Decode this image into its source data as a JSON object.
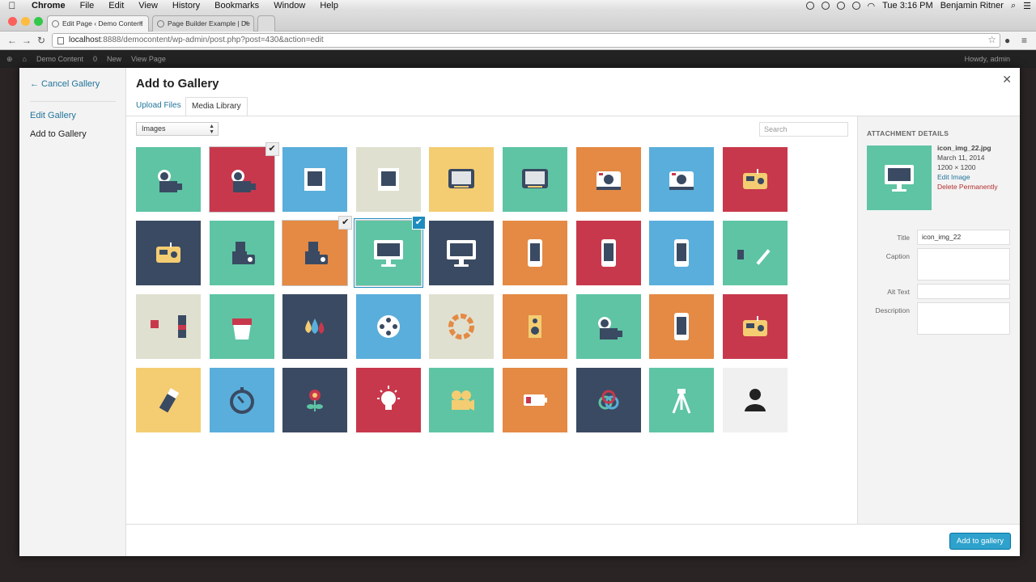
{
  "menubar": {
    "app": "Chrome",
    "items": [
      "File",
      "Edit",
      "View",
      "History",
      "Bookmarks",
      "Window",
      "Help"
    ],
    "clock": "Tue 3:16 PM",
    "user": "Benjamin Ritner"
  },
  "browser": {
    "tabs": [
      "Edit Page ‹ Demo Content",
      "Page Builder Example | De"
    ],
    "url_host": "localhost",
    "url_rest": ":8888/democontent/wp-admin/post.php?post=430&action=edit"
  },
  "adminbar": {
    "items": [
      "Demo Content",
      "0",
      "New",
      "View Page"
    ],
    "howdy": "Howdy, admin"
  },
  "modal": {
    "menu": {
      "cancel": "← Cancel Gallery",
      "edit": "Edit Gallery",
      "add": "Add to Gallery"
    },
    "title": "Add to Gallery",
    "tabs": {
      "upload": "Upload Files",
      "library": "Media Library"
    },
    "filter": "Images",
    "search_placeholder": "Search",
    "add_button": "Add to gallery"
  },
  "tiles": [
    {
      "bg": "#5ec4a4",
      "icon": "camcorder"
    },
    {
      "bg": "#c8384c",
      "icon": "camcorder",
      "selected": true
    },
    {
      "bg": "#5aaedb",
      "icon": "frame"
    },
    {
      "bg": "#e0e0d0",
      "icon": "frame"
    },
    {
      "bg": "#f4cd72",
      "icon": "tv"
    },
    {
      "bg": "#5ec4a4",
      "icon": "tv"
    },
    {
      "bg": "#e48a44",
      "icon": "polaroid"
    },
    {
      "bg": "#5aaedb",
      "icon": "polaroid"
    },
    {
      "bg": "#c8384c",
      "icon": "radio"
    },
    {
      "bg": "#3a4a62",
      "icon": "radio"
    },
    {
      "bg": "#5ec4a4",
      "icon": "camera-set"
    },
    {
      "bg": "#e48a44",
      "icon": "camera-set",
      "selected": true
    },
    {
      "bg": "#5ec4a4",
      "icon": "monitor",
      "selected": true,
      "current": true
    },
    {
      "bg": "#3a4a62",
      "icon": "monitor"
    },
    {
      "bg": "#e48a44",
      "icon": "phone"
    },
    {
      "bg": "#c8384c",
      "icon": "phone"
    },
    {
      "bg": "#5aaedb",
      "icon": "phone"
    },
    {
      "bg": "#5ec4a4",
      "icon": "pencil"
    },
    {
      "bg": "#e0e0d0",
      "icon": "paint"
    },
    {
      "bg": "#5ec4a4",
      "icon": "bucket"
    },
    {
      "bg": "#3a4a62",
      "icon": "drops"
    },
    {
      "bg": "#5aaedb",
      "icon": "reel"
    },
    {
      "bg": "#e0e0d0",
      "icon": "wheel"
    },
    {
      "bg": "#e48a44",
      "icon": "speaker"
    },
    {
      "bg": "#5ec4a4",
      "icon": "camcorder"
    },
    {
      "bg": "#e48a44",
      "icon": "phone"
    },
    {
      "bg": "#c8384c",
      "icon": "radio"
    },
    {
      "bg": "#f4cd72",
      "icon": "marker"
    },
    {
      "bg": "#5aaedb",
      "icon": "timer"
    },
    {
      "bg": "#3a4a62",
      "icon": "flower"
    },
    {
      "bg": "#c8384c",
      "icon": "bulb"
    },
    {
      "bg": "#5ec4a4",
      "icon": "projector"
    },
    {
      "bg": "#e48a44",
      "icon": "battery"
    },
    {
      "bg": "#3a4a62",
      "icon": "rings"
    },
    {
      "bg": "#5ec4a4",
      "icon": "tripod"
    },
    {
      "bg": "#f0f0f0",
      "icon": "person"
    }
  ],
  "details": {
    "heading": "ATTACHMENT DETAILS",
    "filename": "icon_img_22.jpg",
    "date": "March 11, 2014",
    "dimensions": "1200 × 1200",
    "edit": "Edit Image",
    "delete": "Delete Permanently",
    "labels": {
      "title": "Title",
      "caption": "Caption",
      "alt": "Alt Text",
      "description": "Description"
    },
    "title_value": "icon_img_22"
  }
}
